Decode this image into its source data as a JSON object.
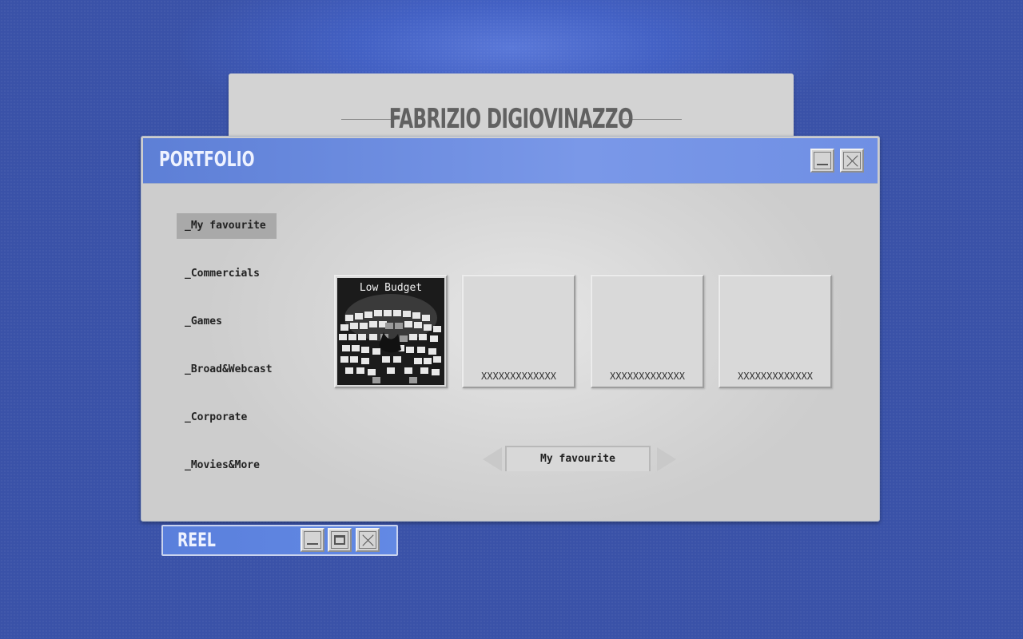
{
  "site": {
    "title": "FABRIZIO DIGIOVINAZZO"
  },
  "portfolio": {
    "title": "PORTFOLIO",
    "nav": [
      {
        "label": "_My favourite",
        "active": true
      },
      {
        "label": "_Commercials",
        "active": false
      },
      {
        "label": "_Games",
        "active": false
      },
      {
        "label": "_Broad&Webcast",
        "active": false
      },
      {
        "label": "_Corporate",
        "active": false
      },
      {
        "label": "_Movies&More",
        "active": false
      }
    ],
    "thumbnails": [
      {
        "title": "Low Budget",
        "caption": ""
      },
      {
        "title": "",
        "caption": "XXXXXXXXXXXXX"
      },
      {
        "title": "",
        "caption": "XXXXXXXXXXXXX"
      },
      {
        "title": "",
        "caption": "XXXXXXXXXXXXX"
      }
    ],
    "pager": {
      "label": "My favourite"
    }
  },
  "reel": {
    "title": "REEL"
  },
  "icons": {
    "minimize": "minimize-icon",
    "maximize": "maximize-icon",
    "close": "close-icon",
    "prev": "arrow-left-icon",
    "next": "arrow-right-icon"
  },
  "colors": {
    "background": "#3b52a9",
    "titlebar": "#6f8fe4",
    "window": "#d6d6d6",
    "active_nav": "#a9a9a9"
  }
}
